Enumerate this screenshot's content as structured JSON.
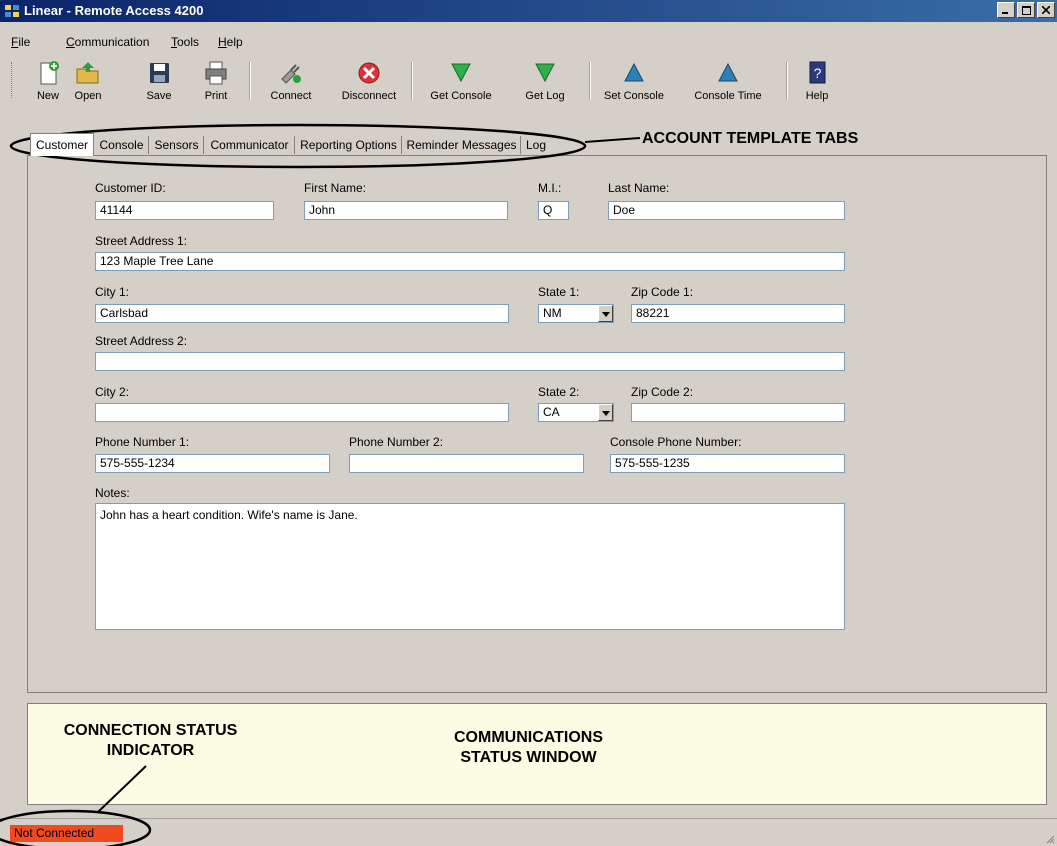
{
  "window": {
    "title": "Linear - Remote Access 4200"
  },
  "menu": [
    {
      "label": "File"
    },
    {
      "label": "Communication"
    },
    {
      "label": "Tools"
    },
    {
      "label": "Help"
    }
  ],
  "toolbar": {
    "new": "New",
    "open": "Open",
    "save": "Save",
    "print": "Print",
    "connect": "Connect",
    "disconnect": "Disconnect",
    "get_console": "Get Console",
    "get_log": "Get Log",
    "set_console": "Set Console",
    "console_time": "Console Time",
    "help": "Help"
  },
  "tabs": [
    {
      "label": "Customer",
      "active": true
    },
    {
      "label": "Console"
    },
    {
      "label": "Sensors"
    },
    {
      "label": "Communicator"
    },
    {
      "label": "Reporting Options"
    },
    {
      "label": "Reminder Messages"
    },
    {
      "label": "Log"
    }
  ],
  "customer": {
    "customer_id_label": "Customer ID:",
    "customer_id": "41144",
    "first_name_label": "First Name:",
    "first_name": "John",
    "mi_label": "M.I.:",
    "mi": "Q",
    "last_name_label": "Last Name:",
    "last_name": "Doe",
    "street1_label": "Street Address 1:",
    "street1": "123 Maple Tree Lane",
    "city1_label": "City 1:",
    "city1": "Carlsbad",
    "state1_label": "State 1:",
    "state1": "NM",
    "zip1_label": "Zip Code 1:",
    "zip1": "88221",
    "street2_label": "Street Address 2:",
    "street2": "",
    "city2_label": "City 2:",
    "city2": "",
    "state2_label": "State 2:",
    "state2": "CA",
    "zip2_label": "Zip Code 2:",
    "zip2": "",
    "phone1_label": "Phone Number 1:",
    "phone1": "575-555-1234",
    "phone2_label": "Phone Number 2:",
    "phone2": "",
    "console_phone_label": "Console Phone Number:",
    "console_phone": "575-555-1235",
    "notes_label": "Notes:",
    "notes": "John has a heart condition. Wife's name is Jane."
  },
  "status": {
    "connection": "Not Connected"
  },
  "callouts": {
    "account_tabs": "ACCOUNT TEMPLATE TABS",
    "connection_status_line1": "CONNECTION STATUS",
    "connection_status_line2": "INDICATOR",
    "comm_status_line1": "COMMUNICATIONS",
    "comm_status_line2": "STATUS WINDOW"
  },
  "colors": {
    "title_bar": "#0a246a",
    "window_bg": "#d4d0c8",
    "status_window_bg": "#fcfbe3",
    "not_connected": "#f04a22"
  }
}
